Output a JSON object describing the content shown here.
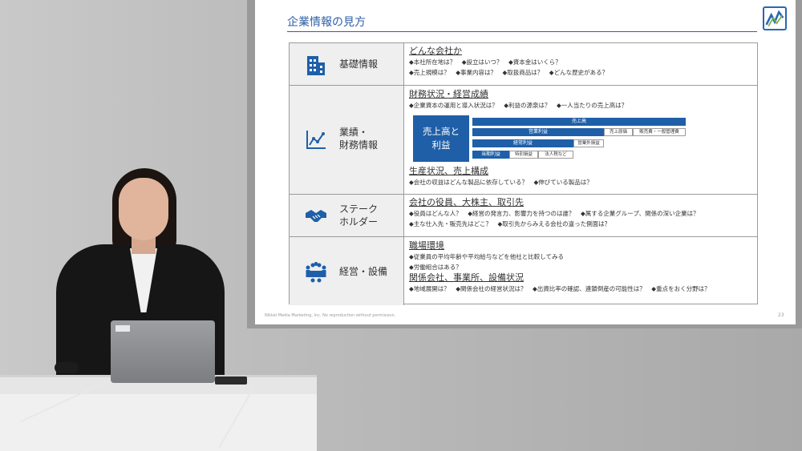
{
  "slide": {
    "title": "企業情報の見方",
    "footer": "Nikkei Media Marketing, Inc. No reproduction without permission.",
    "page_number": "23",
    "accent_color": "#1f5fa8",
    "rows": [
      {
        "category": "基礎情報",
        "icon": "building-icon",
        "heading": "どんな会社か",
        "questions": [
          "◆本社所在地は？　◆設立はいつ？　◆資本金はいくら？",
          "◆売上規模は？　◆事業内容は？　◆取扱商品は？　◆どんな歴史がある？"
        ]
      },
      {
        "category_line1": "業績・",
        "category_line2": "財務情報",
        "icon": "line-chart-icon",
        "heading": "財務状況・経営成績",
        "questions": [
          "◆企業資本の運用と導入状況は？　◆利益の源泉は？　◆一人当たりの売上高は？"
        ],
        "diagram": {
          "main_line1": "売上高と",
          "main_line2": "利益",
          "sales": "売上高",
          "operating_profit": "営業利益",
          "cost_of_sales": "売上原価",
          "sga": "販売費・一般管理費",
          "ordinary_profit": "経常利益",
          "non_operating": "営業外損益",
          "net_profit": "当期利益",
          "extraordinary": "特別損益",
          "taxes": "法人税など"
        },
        "heading2": "生産状況、売上構成",
        "questions2": [
          "◆会社の収益はどんな製品に依存している？　◆伸びている製品は？"
        ]
      },
      {
        "category_line1": "ステーク",
        "category_line2": "ホルダー",
        "icon": "handshake-icon",
        "heading": "会社の役員、大株主、取引先",
        "questions": [
          "◆役員はどんな人？　◆経営の発言力、影響力を持つのは誰？　◆属する企業グループ、関係の深い企業は？",
          "◆主な仕入先・販売先はどこ？　◆取引先からみえる会社の違った側面は？"
        ]
      },
      {
        "category": "経営・設備",
        "icon": "meeting-icon",
        "heading": "職場環境",
        "questions": [
          "◆従業員の平均年齢や平均給与などを他社と比較してみる",
          "◆労働組合はある？"
        ],
        "heading2": "関係会社、事業所、設備状況",
        "questions2": [
          "◆地域展開は？　◆関係会社の経営状況は？　◆出資比率の確認、連鎖倒産の可能性は？　◆重点をおく分野は？"
        ]
      }
    ]
  }
}
